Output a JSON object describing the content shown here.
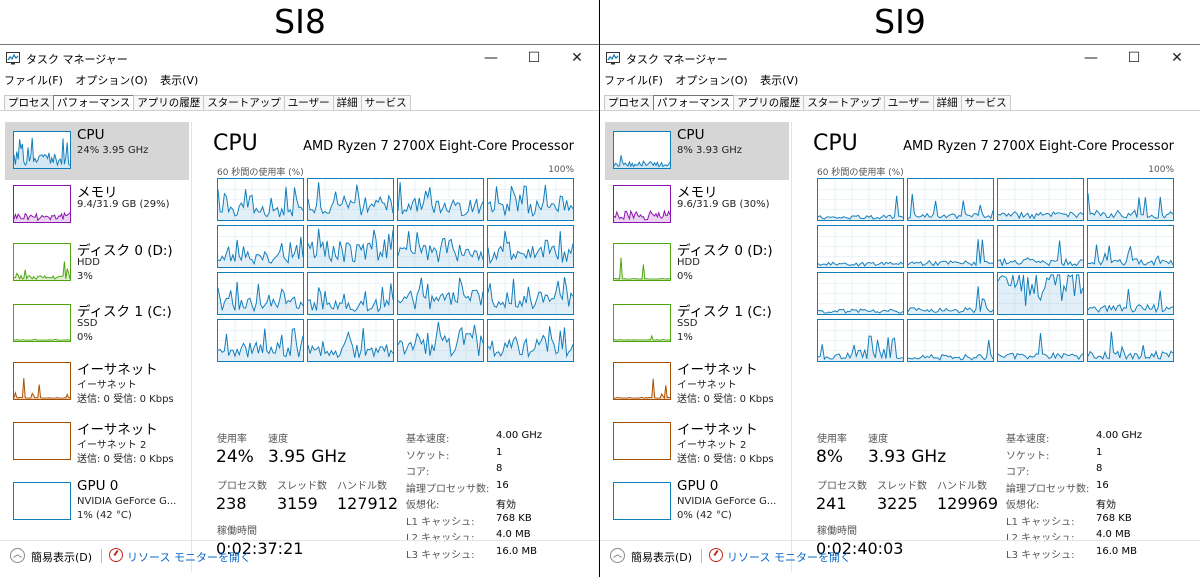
{
  "panels": [
    {
      "label": "SI8",
      "window_title": "タスク マネージャー",
      "menu": [
        "ファイル(F)",
        "オプション(O)",
        "表示(V)"
      ],
      "tabs": [
        "プロセス",
        "パフォーマンス",
        "アプリの履歴",
        "スタートアップ",
        "ユーザー",
        "詳細",
        "サービス"
      ],
      "active_tab": 1,
      "sidebar": [
        {
          "title": "CPU",
          "line1": "24%  3.95 GHz",
          "line2": "",
          "color": "#117dbb"
        },
        {
          "title": "メモリ",
          "line1": "9.4/31.9 GB (29%)",
          "line2": "",
          "color": "#8b12ae"
        },
        {
          "title": "ディスク 0 (D:)",
          "line1": "HDD",
          "line2": "3%",
          "color": "#4da60c"
        },
        {
          "title": "ディスク 1 (C:)",
          "line1": "SSD",
          "line2": "0%",
          "color": "#4da60c"
        },
        {
          "title": "イーサネット",
          "line1": "イーサネット",
          "line2": "送信: 0 受信: 0 Kbps",
          "color": "#a74f01"
        },
        {
          "title": "イーサネット",
          "line1": "イーサネット 2",
          "line2": "送信: 0 受信: 0 Kbps",
          "color": "#a74f01"
        },
        {
          "title": "GPU 0",
          "line1": "NVIDIA GeForce G...",
          "line2": "1% (42 °C)",
          "color": "#117dbb"
        }
      ],
      "main": {
        "heading": "CPU",
        "cpu_name": "AMD Ryzen 7 2700X Eight-Core Processor",
        "graph_caption": "60 秒間の使用率 (%)",
        "graph_max": "100%",
        "stats": {
          "usage_label": "使用率",
          "usage": "24%",
          "speed_label": "速度",
          "speed": "3.95 GHz",
          "processes_label": "プロセス数",
          "processes": "238",
          "threads_label": "スレッド数",
          "threads": "3159",
          "handles_label": "ハンドル数",
          "handles": "127912",
          "uptime_label": "稼働時間",
          "uptime": "0:02:37:21"
        },
        "specs": [
          {
            "k": "基本速度:",
            "v": "4.00 GHz"
          },
          {
            "k": "ソケット:",
            "v": "1"
          },
          {
            "k": "コア:",
            "v": "8"
          },
          {
            "k": "論理プロセッサ数:",
            "v": "16"
          },
          {
            "k": "仮想化:",
            "v": "有効"
          },
          {
            "k": "L1 キャッシュ:",
            "v": "768 KB"
          },
          {
            "k": "L2 キャッシュ:",
            "v": "4.0 MB"
          },
          {
            "k": "L3 キャッシュ:",
            "v": "16.0 MB"
          }
        ]
      },
      "footer": {
        "fewer": "簡易表示(D)",
        "resmon": "リソース モニターを開く"
      }
    },
    {
      "label": "SI9",
      "window_title": "タスク マネージャー",
      "menu": [
        "ファイル(F)",
        "オプション(O)",
        "表示(V)"
      ],
      "tabs": [
        "プロセス",
        "パフォーマンス",
        "アプリの履歴",
        "スタートアップ",
        "ユーザー",
        "詳細",
        "サービス"
      ],
      "active_tab": 1,
      "sidebar": [
        {
          "title": "CPU",
          "line1": "8%  3.93 GHz",
          "line2": "",
          "color": "#117dbb"
        },
        {
          "title": "メモリ",
          "line1": "9.6/31.9 GB (30%)",
          "line2": "",
          "color": "#8b12ae"
        },
        {
          "title": "ディスク 0 (D:)",
          "line1": "HDD",
          "line2": "0%",
          "color": "#4da60c"
        },
        {
          "title": "ディスク 1 (C:)",
          "line1": "SSD",
          "line2": "1%",
          "color": "#4da60c"
        },
        {
          "title": "イーサネット",
          "line1": "イーサネット",
          "line2": "送信: 0 受信: 0 Kbps",
          "color": "#a74f01"
        },
        {
          "title": "イーサネット",
          "line1": "イーサネット 2",
          "line2": "送信: 0 受信: 0 Kbps",
          "color": "#a74f01"
        },
        {
          "title": "GPU 0",
          "line1": "NVIDIA GeForce G...",
          "line2": "0% (42 °C)",
          "color": "#117dbb"
        }
      ],
      "main": {
        "heading": "CPU",
        "cpu_name": "AMD Ryzen 7 2700X Eight-Core Processor",
        "graph_caption": "60 秒間の使用率 (%)",
        "graph_max": "100%",
        "stats": {
          "usage_label": "使用率",
          "usage": "8%",
          "speed_label": "速度",
          "speed": "3.93 GHz",
          "processes_label": "プロセス数",
          "processes": "241",
          "threads_label": "スレッド数",
          "threads": "3225",
          "handles_label": "ハンドル数",
          "handles": "129969",
          "uptime_label": "稼働時間",
          "uptime": "0:02:40:03"
        },
        "specs": [
          {
            "k": "基本速度:",
            "v": "4.00 GHz"
          },
          {
            "k": "ソケット:",
            "v": "1"
          },
          {
            "k": "コア:",
            "v": "8"
          },
          {
            "k": "論理プロセッサ数:",
            "v": "16"
          },
          {
            "k": "仮想化:",
            "v": "有効"
          },
          {
            "k": "L1 キャッシュ:",
            "v": "768 KB"
          },
          {
            "k": "L2 キャッシュ:",
            "v": "4.0 MB"
          },
          {
            "k": "L3 キャッシュ:",
            "v": "16.0 MB"
          }
        ]
      },
      "footer": {
        "fewer": "簡易表示(D)",
        "resmon": "リソース モニターを開く"
      }
    }
  ]
}
